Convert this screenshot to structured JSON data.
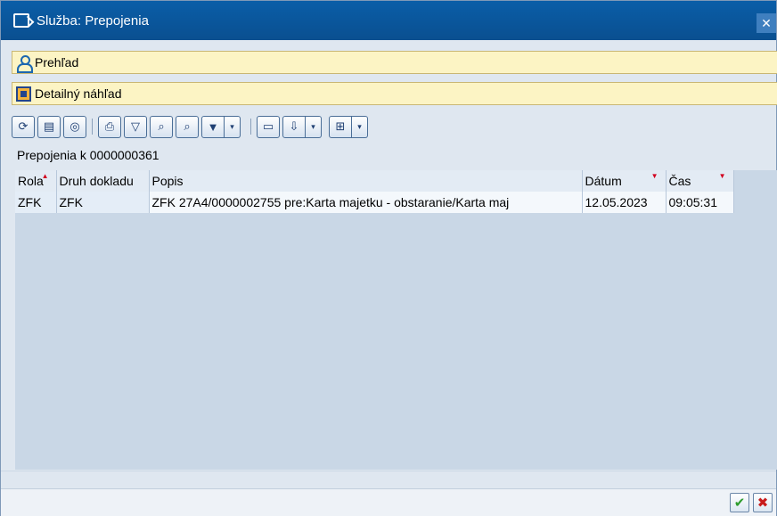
{
  "window": {
    "title": "Služba: Prepojenia",
    "close_label": "✕"
  },
  "trays": [
    {
      "label": "Prehľad",
      "icon": "person-icon"
    },
    {
      "label": "Detailný náhľad",
      "icon": "detail-view-icon"
    }
  ],
  "toolbar": {
    "buttons": [
      {
        "name": "refresh-icon",
        "glyph": "⟳"
      },
      {
        "name": "detail-icon",
        "glyph": "▤"
      },
      {
        "name": "zoom-icon",
        "glyph": "◎"
      },
      {
        "name": "print-icon",
        "glyph": "⎙"
      },
      {
        "name": "filter-icon",
        "glyph": "▽"
      },
      {
        "name": "find-icon",
        "glyph": "⌕"
      },
      {
        "name": "find-next-icon",
        "glyph": "⌕"
      },
      {
        "name": "set-filter-icon",
        "glyph": "▼"
      },
      {
        "name": "filter-menu-icon",
        "glyph": "▾"
      },
      {
        "name": "print-preview-icon",
        "glyph": "▭"
      },
      {
        "name": "export-icon",
        "glyph": "⇩"
      },
      {
        "name": "export-menu-icon",
        "glyph": "▾"
      },
      {
        "name": "layout-icon",
        "glyph": "⊞"
      },
      {
        "name": "layout-menu-icon",
        "glyph": "▾"
      }
    ]
  },
  "heading": "Prepojenia k 0000000361",
  "table": {
    "columns": [
      "Rola",
      "Druh dokladu",
      "Popis",
      "Dátum",
      "Čas"
    ],
    "rows": [
      [
        "ZFK",
        "ZFK",
        "ZFK 27A4/0000002755 pre:Karta majetku - obstaranie/Karta maj",
        "12.05.2023",
        "09:05:31"
      ]
    ]
  },
  "footer": {
    "ok_label": "✔",
    "cancel_label": "✖"
  },
  "colors": {
    "titlebar": "#0a5ea8",
    "tray": "#fcf4c4",
    "grid_bg": "#c9d7e6"
  }
}
